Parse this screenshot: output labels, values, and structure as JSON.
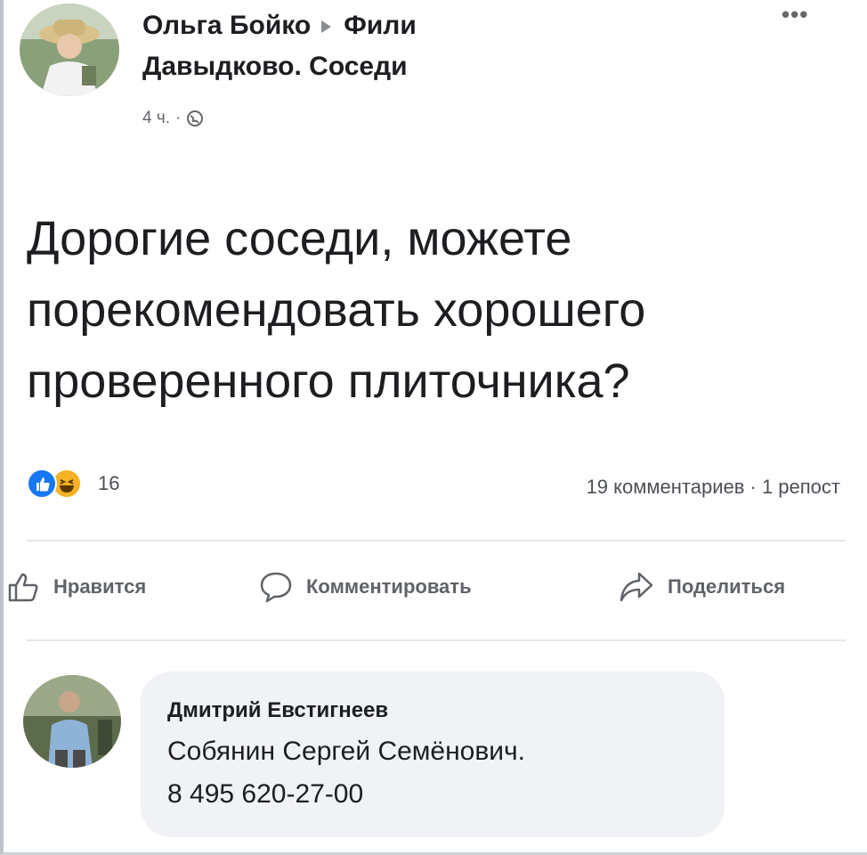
{
  "post": {
    "author": "Ольга Бойко",
    "group_line1": "Фили",
    "group_line2": "Давыдково. Соседи",
    "time": "4 ч.",
    "separator": "·",
    "text": "Дорогие соседи, можете порекомендовать хорошего проверенного плиточника?"
  },
  "reactions": {
    "count": "16",
    "types": [
      "like",
      "haha"
    ]
  },
  "stats": {
    "text": "19 комментариев · 1 репост"
  },
  "actions": {
    "like": "Нравится",
    "comment": "Комментировать",
    "share": "Поделиться"
  },
  "comment": {
    "author": "Дмитрий Евстигнеев",
    "line1": "Собянин Сергей Семёнович.",
    "line2": "8 495 620-27-00"
  },
  "icons": [
    "more-icon",
    "globe-icon",
    "like-reaction-icon",
    "haha-reaction-icon",
    "thumbs-up-icon",
    "comment-icon",
    "share-icon",
    "arrow-right-icon"
  ],
  "colors": {
    "like_blue": "#1877f2",
    "haha_yellow": "#f7b125",
    "bubble_bg": "#f0f2f5",
    "secondary_text": "#65676b"
  }
}
